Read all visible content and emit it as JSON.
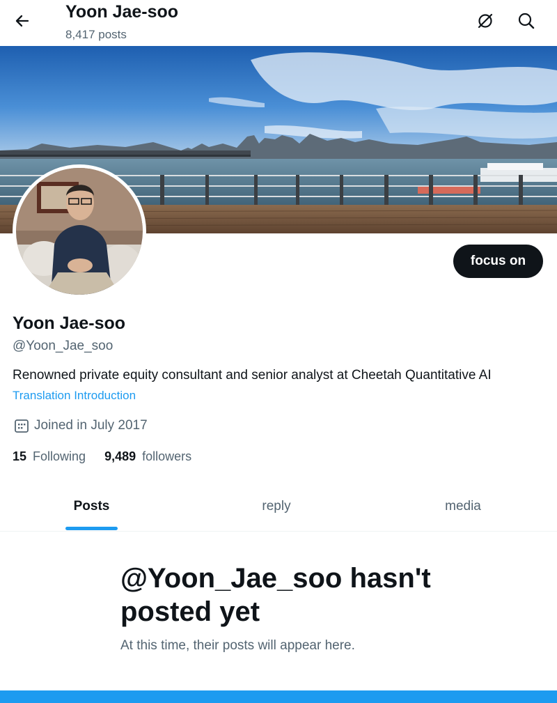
{
  "header": {
    "title": "Yoon Jae-soo",
    "post_count": "8,417 posts",
    "back_icon": "arrow-left-icon",
    "dark_mode_icon": "dark-mode-toggle-icon",
    "search_icon": "search-icon"
  },
  "profile": {
    "display_name": "Yoon Jae-soo",
    "handle": "@Yoon_Jae_soo",
    "bio": "Renowned private equity consultant and senior analyst at Cheetah Quantitative AI",
    "translate_label": "Translation Introduction",
    "joined": "Joined in July 2017",
    "follow_button": "focus on",
    "following_count": "15",
    "following_label": "Following",
    "followers_count": "9,489",
    "followers_label": "followers"
  },
  "tabs": [
    {
      "label": "Posts",
      "active": true
    },
    {
      "label": "reply",
      "active": false
    },
    {
      "label": "media",
      "active": false
    }
  ],
  "empty_state": {
    "title": "@Yoon_Jae_soo hasn't posted yet",
    "subtitle": "At this time, their posts will appear here."
  },
  "colors": {
    "accent": "#1d9bf0",
    "text_primary": "#0f1419",
    "text_secondary": "#536471",
    "button_dark": "#0f1419"
  }
}
